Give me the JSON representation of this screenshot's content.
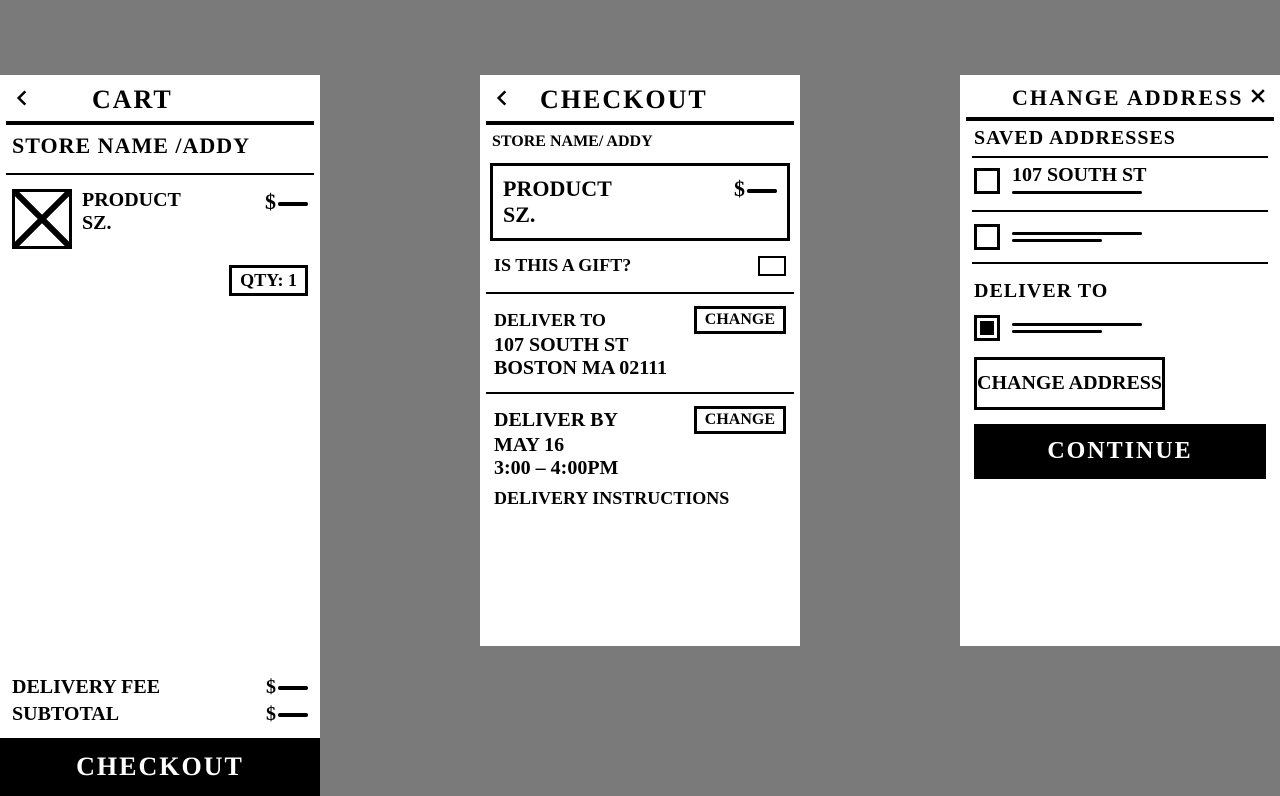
{
  "cart": {
    "title": "CART",
    "store": "STORE NAME /ADDY",
    "product_name": "PRODUCT",
    "product_size": "SZ.",
    "price_prefix": "$",
    "qty_label": "QTY: 1",
    "delivery_fee_label": "DELIVERY FEE",
    "delivery_fee_value": "$",
    "subtotal_label": "SUBTOTAL",
    "subtotal_value": "$",
    "cta": "CHECKOUT"
  },
  "checkout": {
    "title": "CHECKOUT",
    "store": "STORE NAME/ ADDY",
    "product_name": "PRODUCT",
    "product_size": "SZ.",
    "price_prefix": "$",
    "gift_q": "IS THIS A GIFT?",
    "deliver_to_label": "DELIVER TO",
    "addr_line1": "107 SOUTH ST",
    "addr_line2": "BOSTON MA 02111",
    "change_btn": "CHANGE",
    "deliver_by_label": "DELIVER BY",
    "deliver_date": "MAY 16",
    "deliver_time": "3:00 – 4:00PM",
    "instructions_label": "DELIVERY INSTRUCTIONS"
  },
  "change_addr": {
    "title": "CHANGE ADDRESS",
    "saved_label": "SAVED ADDRESSES",
    "addr1": "107 SOUTH ST",
    "deliver_to_label": "DELIVER TO",
    "big_btn": "CHANGE ADDRESS",
    "cta": "CONTINUE"
  }
}
